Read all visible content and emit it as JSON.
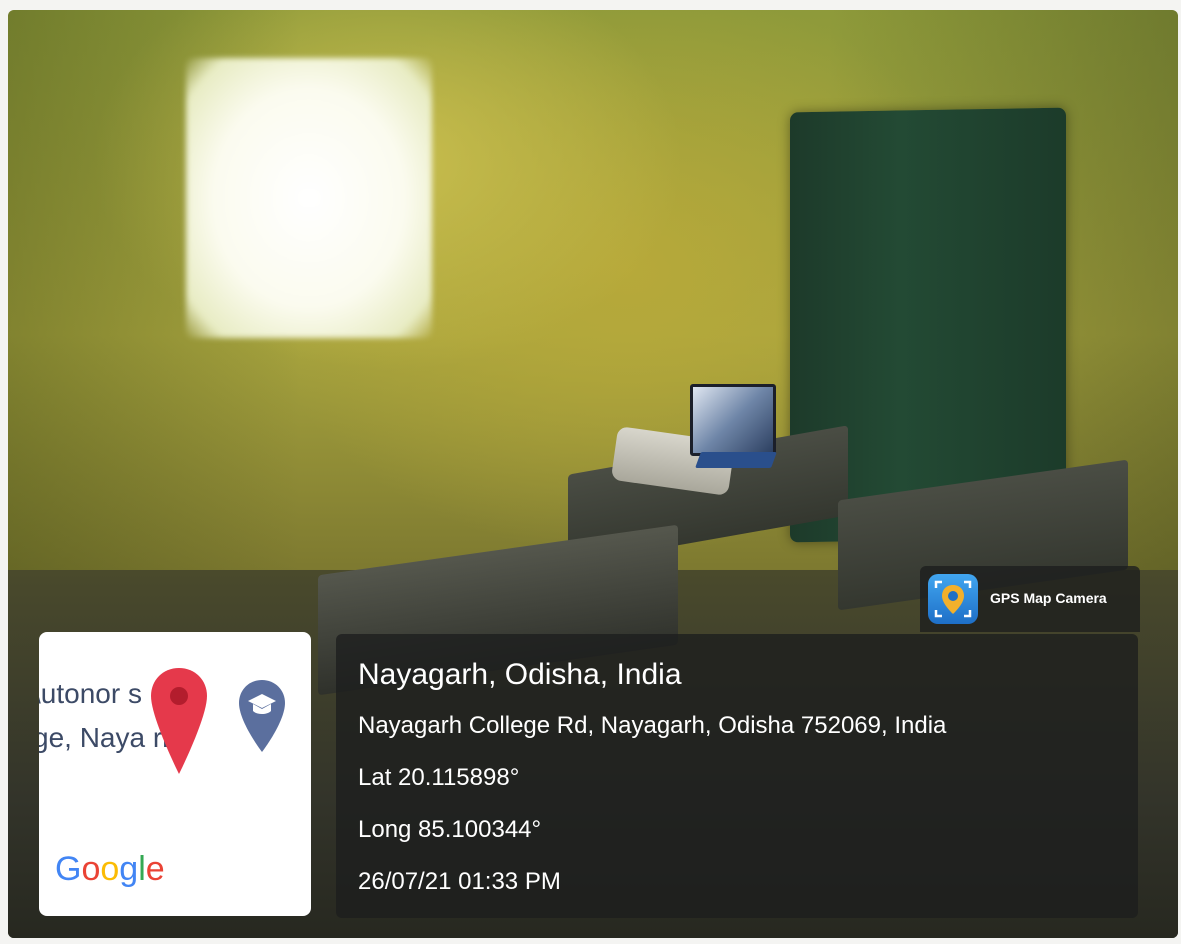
{
  "map_card": {
    "label_line1": "\\utonor   s",
    "label_line2": "ge, Naya   rh",
    "google_letters": [
      {
        "ch": "G",
        "color": "#4285F4"
      },
      {
        "ch": "o",
        "color": "#EA4335"
      },
      {
        "ch": "o",
        "color": "#FBBC05"
      },
      {
        "ch": "g",
        "color": "#4285F4"
      },
      {
        "ch": "l",
        "color": "#34A853"
      },
      {
        "ch": "e",
        "color": "#EA4335"
      }
    ],
    "pin_icon": "map-pin-icon",
    "edu_icon": "graduation-cap-pin-icon"
  },
  "watermark": {
    "app_name": "GPS Map Camera",
    "app_icon": "gps-map-camera-icon"
  },
  "info": {
    "title": "Nayagarh, Odisha, India",
    "address": "Nayagarh College Rd, Nayagarh, Odisha 752069, India",
    "lat": "Lat 20.115898°",
    "long": "Long 85.100344°",
    "datetime": "26/07/21 01:33 PM"
  }
}
